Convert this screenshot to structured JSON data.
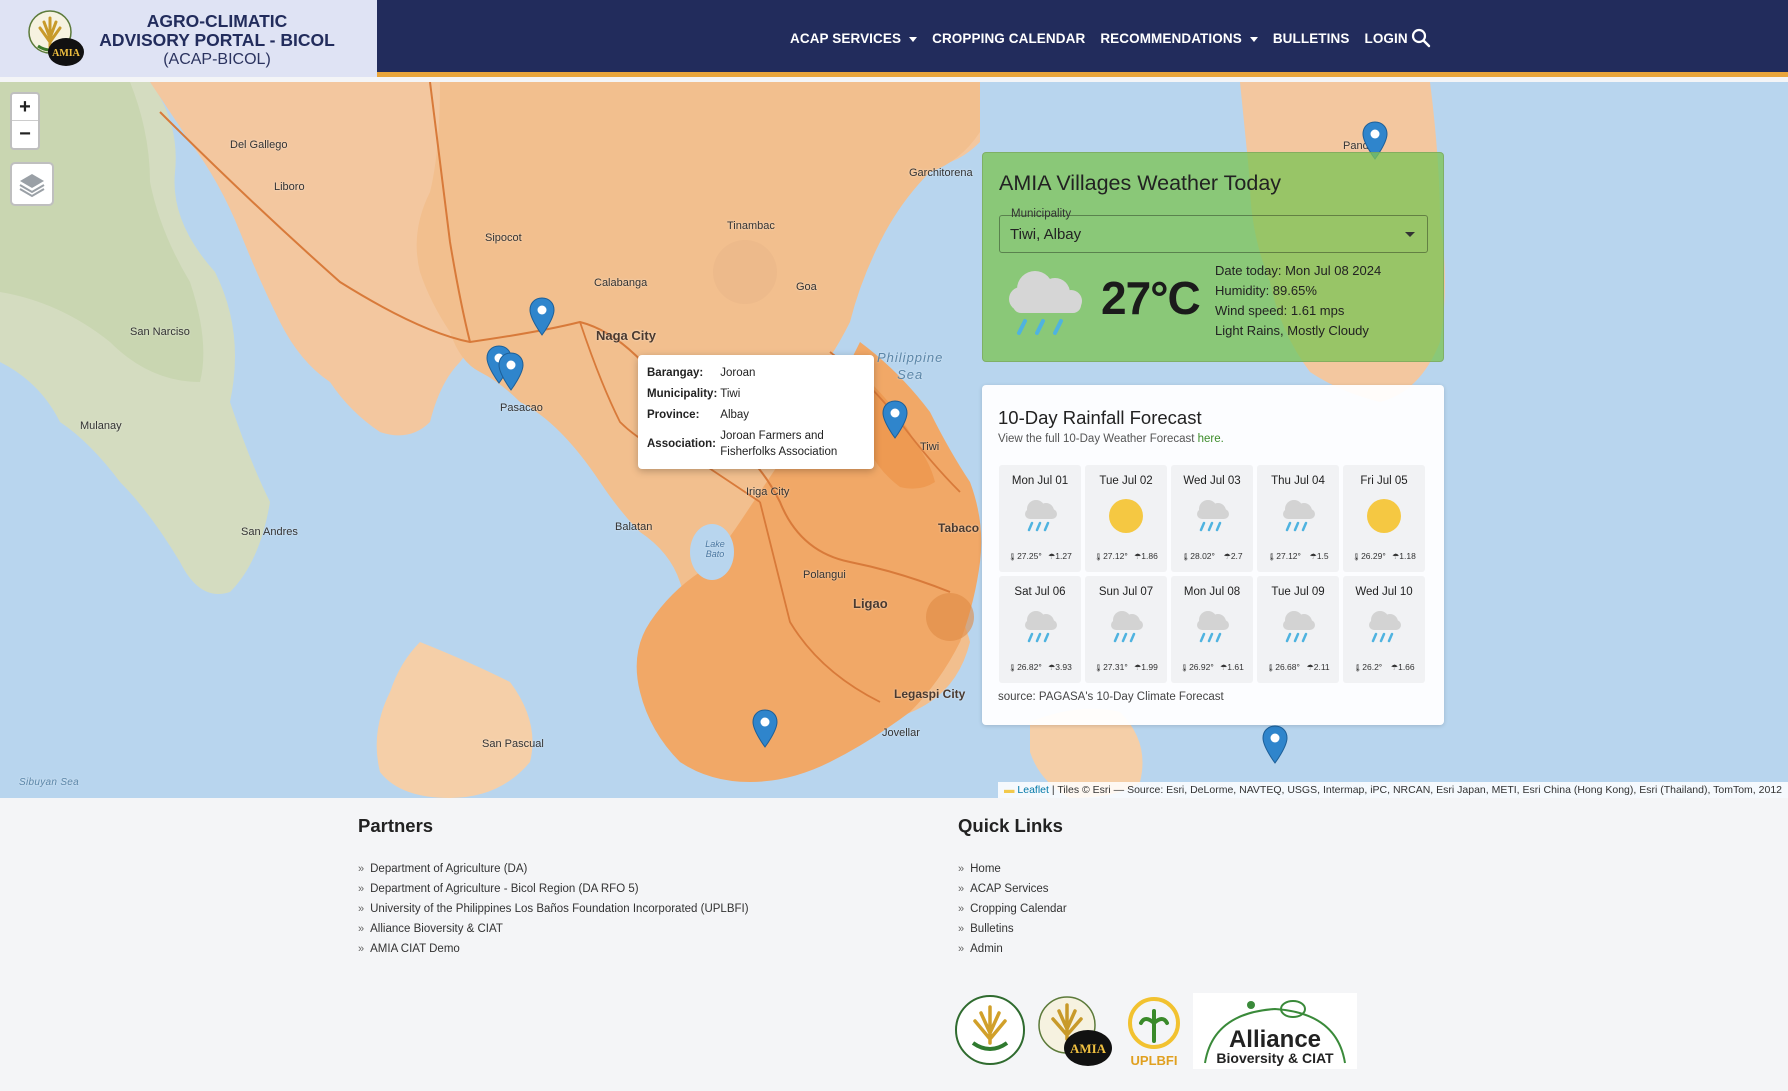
{
  "header": {
    "brand_line1": "AGRO-CLIMATIC",
    "brand_line2": "ADVISORY PORTAL - BICOL",
    "brand_line3": "(ACAP-BICOL)",
    "nav": [
      {
        "label": "ACAP SERVICES",
        "dropdown": true
      },
      {
        "label": "CROPPING CALENDAR",
        "dropdown": false
      },
      {
        "label": "RECOMMENDATIONS",
        "dropdown": true
      },
      {
        "label": "BULLETINS",
        "dropdown": false
      },
      {
        "label": "LOGIN",
        "dropdown": false
      }
    ],
    "search_icon": "search-icon"
  },
  "map": {
    "places": {
      "del_gallego": "Del Gallego",
      "libmanan": "Liboro",
      "sipocot": "Sipocot",
      "garchitorena": "Garchitorena",
      "tinambac": "Tinambac",
      "calabanga": "Calabanga",
      "goa": "Goa",
      "naga": "Naga City",
      "san_narciso": "San Narciso",
      "pasacao": "Pasacao",
      "mulanay": "Mulanay",
      "san_andres": "San Andres",
      "iriga": "Iriga City",
      "balatan": "Balatan",
      "lake_bato": "Lake Bato",
      "polangui": "Polangui",
      "ligao": "Ligao",
      "tabaco": "Tabaco",
      "tiwi": "Tiwi",
      "legaspi": "Legaspi City",
      "jovellar": "Jovellar",
      "san_pascual": "San Pascual",
      "sibuyan_sea": "Sibuyan Sea",
      "philippine_sea_1": "Philippine",
      "philippine_sea_2": "Sea",
      "pandan": "Pandan"
    },
    "popup": {
      "barangay_label": "Barangay:",
      "barangay": "Joroan",
      "municipality_label": "Municipality:",
      "municipality": "Tiwi",
      "province_label": "Province:",
      "province": "Albay",
      "association_label": "Association:",
      "association": "Joroan Farmers and Fisherfolks Association"
    },
    "attribution": "| Tiles © Esri — Source: Esri, DeLorme, NAVTEQ, USGS, Intermap, iPC, NRCAN, Esri Japan, METI, Esri China (Hong Kong), Esri (Thailand), TomTom, 2012",
    "attribution_link": "Leaflet",
    "zoom_in": "+",
    "zoom_out": "−"
  },
  "weather_today": {
    "title": "AMIA Villages Weather Today",
    "municipality_label": "Municipality",
    "municipality_value": "Tiwi, Albay",
    "temperature": "27°C",
    "date": "Date today: Mon Jul 08 2024",
    "humidity": "Humidity: 89.65%",
    "wind": "Wind speed: 1.61 mps",
    "condition": "Light Rains, Mostly Cloudy",
    "icon": "rain-cloud-icon"
  },
  "rainfall_forecast": {
    "title": "10-Day Rainfall Forecast",
    "subtitle_prefix": "View the full 10-Day Weather Forecast ",
    "subtitle_link": "here.",
    "source": "source: PAGASA's 10-Day Climate Forecast",
    "days": [
      {
        "name": "Mon Jul 01",
        "icon": "rain",
        "temp": "27.25°",
        "rain": "1.27"
      },
      {
        "name": "Tue Jul 02",
        "icon": "sun",
        "temp": "27.12°",
        "rain": "1.86"
      },
      {
        "name": "Wed Jul 03",
        "icon": "rain",
        "temp": "28.02°",
        "rain": "2.7"
      },
      {
        "name": "Thu Jul 04",
        "icon": "rain",
        "temp": "27.12°",
        "rain": "1.5"
      },
      {
        "name": "Fri Jul 05",
        "icon": "sun",
        "temp": "26.29°",
        "rain": "1.18"
      },
      {
        "name": "Sat Jul 06",
        "icon": "rain",
        "temp": "26.82°",
        "rain": "3.93"
      },
      {
        "name": "Sun Jul 07",
        "icon": "rain",
        "temp": "27.31°",
        "rain": "1.99"
      },
      {
        "name": "Mon Jul 08",
        "icon": "rain",
        "temp": "26.92°",
        "rain": "1.61"
      },
      {
        "name": "Tue Jul 09",
        "icon": "rain",
        "temp": "26.68°",
        "rain": "2.11"
      },
      {
        "name": "Wed Jul 10",
        "icon": "rain",
        "temp": "26.2°",
        "rain": "1.66"
      }
    ]
  },
  "footer": {
    "partners_title": "Partners",
    "partners": [
      "Department of Agriculture (DA)",
      "Department of Agriculture - Bicol Region (DA RFO 5)",
      "University of the Philippines Los Baños Foundation Incorporated (UPLBFI)",
      "Alliance Bioversity & CIAT",
      "AMIA CIAT Demo"
    ],
    "quick_links_title": "Quick Links",
    "quick_links": [
      "Home",
      "ACAP Services",
      "Cropping Calendar",
      "Bulletins",
      "Admin"
    ],
    "logos": {
      "uplbfi": "UPLBFI",
      "alliance_1": "Alliance",
      "alliance_2": "Bioversity & CIAT",
      "amia": "AMIA"
    }
  }
}
